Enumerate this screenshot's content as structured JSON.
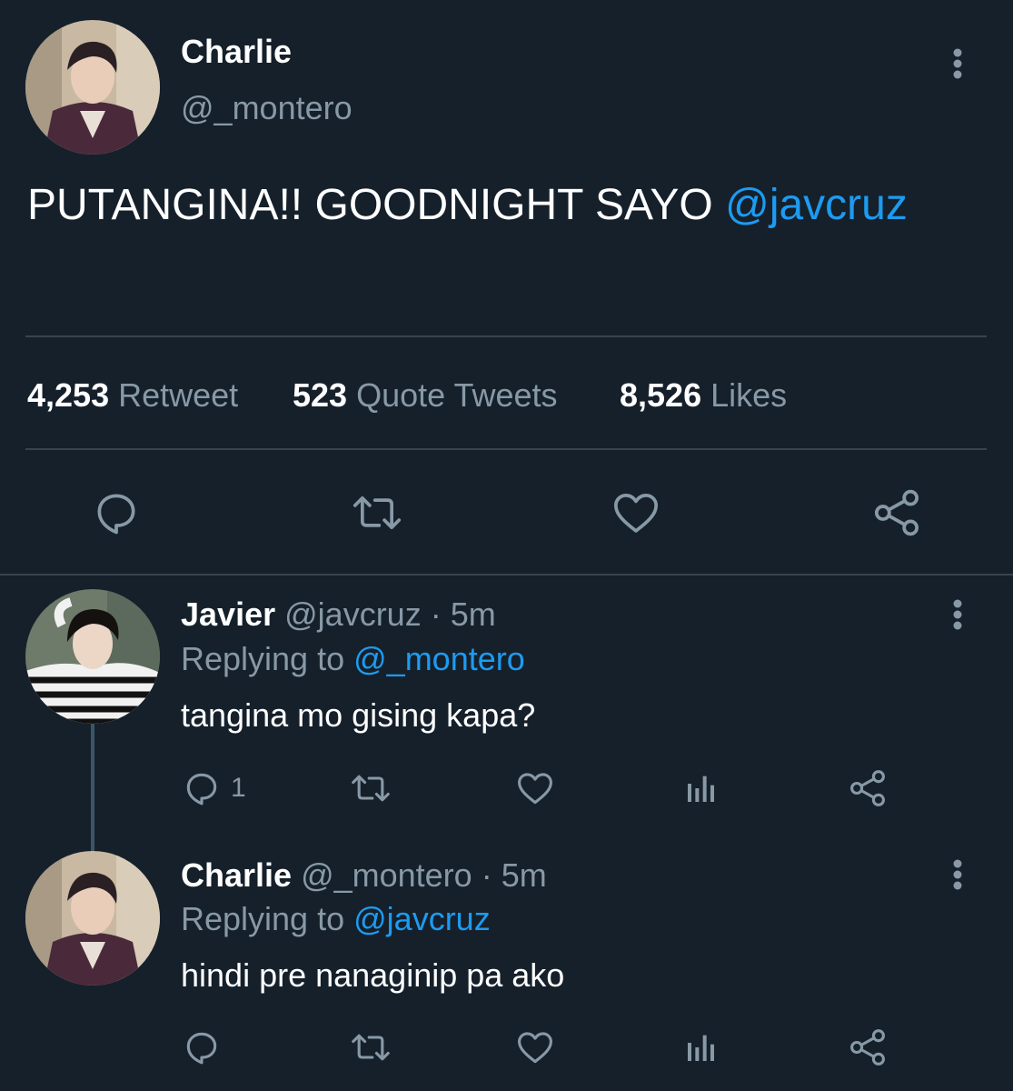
{
  "tweet": {
    "author_name": "Charlie",
    "author_handle": "@_montero",
    "text": "PUTANGINA!! GOODNIGHT SAYO ",
    "mention": "@javcruz",
    "stats": {
      "retweets_count": "4,253",
      "retweets_label": "Retweet",
      "quotes_count": "523",
      "quotes_label": "Quote Tweets",
      "likes_count": "8,526",
      "likes_label": "Likes"
    }
  },
  "replies": [
    {
      "author_name": "Javier",
      "author_handle": "@javcruz",
      "separator": "·",
      "time": "5m",
      "replying_prefix": "Replying to",
      "replying_to": "@_montero",
      "text": "tangina mo gising kapa?",
      "reply_count": "1"
    },
    {
      "author_name": "Charlie",
      "author_handle": "@_montero",
      "separator": "·",
      "time": "5m",
      "replying_prefix": "Replying to",
      "replying_to": "@javcruz",
      "text": "hindi pre nanaginip pa ako",
      "reply_count": ""
    }
  ],
  "colors": {
    "background": "#15202b",
    "muted_text": "#8899a6",
    "link": "#1d9bf0",
    "divider": "#38444d"
  },
  "icons": [
    "more-vertical-icon",
    "reply-icon",
    "retweet-icon",
    "like-icon",
    "share-icon",
    "analytics-icon"
  ]
}
